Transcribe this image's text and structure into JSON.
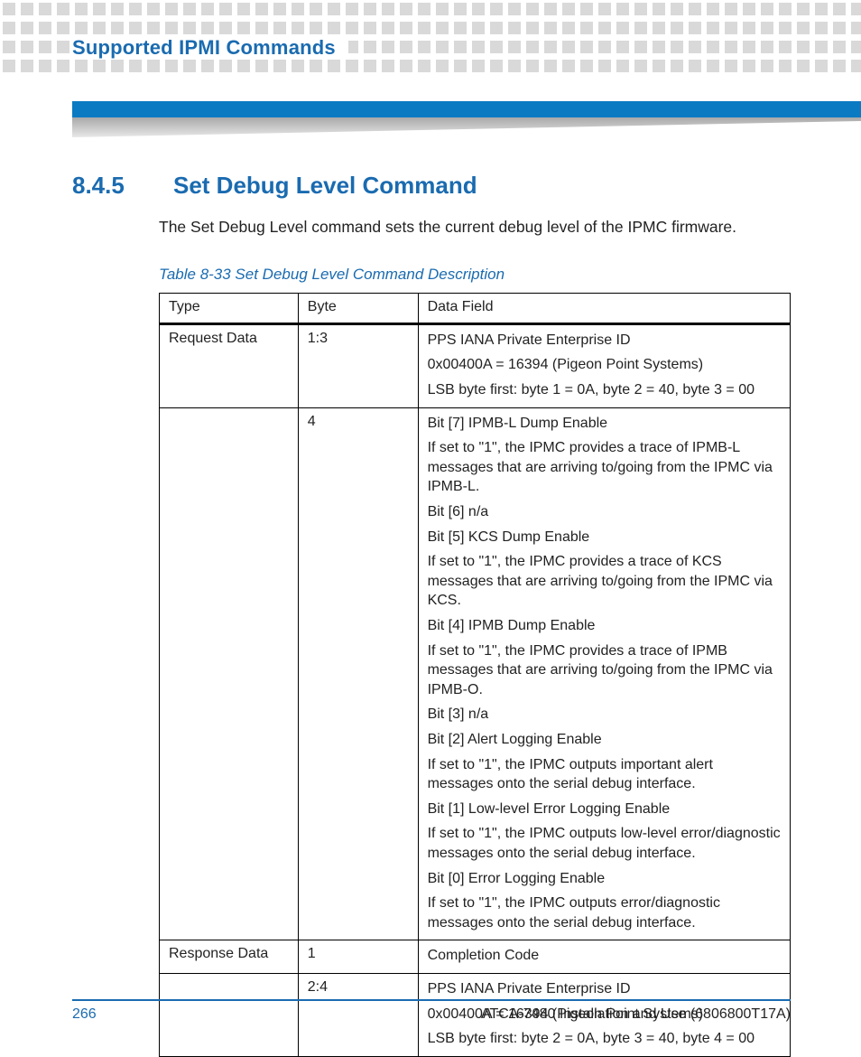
{
  "chapter_title": "Supported IPMI Commands",
  "section": {
    "number": "8.4.5",
    "title": "Set Debug Level Command",
    "intro": "The Set Debug Level command sets the current debug level of the IPMC firmware."
  },
  "table": {
    "caption": "Table 8-33 Set Debug Level Command Description",
    "headers": {
      "c1": "Type",
      "c2": "Byte",
      "c3": "Data Field"
    },
    "rows": [
      {
        "type": "Request Data",
        "byte": "1:3",
        "lines": [
          "PPS IANA Private Enterprise ID",
          "0x00400A = 16394 (Pigeon Point Systems)",
          "LSB byte first: byte 1 = 0A, byte 2 = 40, byte 3 = 00"
        ]
      },
      {
        "type": "",
        "byte": "4",
        "lines": [
          "Bit [7] IPMB-L Dump Enable",
          "If set to \"1\", the IPMC provides a trace of IPMB-L messages that are arriving to/going from the IPMC via IPMB-L.",
          "Bit [6] n/a",
          "Bit [5] KCS Dump Enable",
          "If set to \"1\", the IPMC provides a trace of KCS messages that are arriving to/going from the IPMC via KCS.",
          "Bit [4] IPMB Dump Enable",
          "If set to \"1\", the IPMC provides a trace of IPMB messages that are arriving to/going from the IPMC via IPMB-O.",
          "Bit [3] n/a",
          "Bit [2] Alert Logging Enable",
          "If set to \"1\", the IPMC outputs important alert messages onto the serial debug interface.",
          "Bit [1] Low-level Error Logging Enable",
          "If set to \"1\", the IPMC outputs low-level error/diagnostic messages onto the serial debug interface.",
          "Bit [0] Error Logging Enable",
          "If set to \"1\", the IPMC outputs error/diagnostic messages onto the serial debug interface."
        ]
      },
      {
        "type": "Response Data",
        "byte": "1",
        "lines": [
          "Completion Code"
        ]
      },
      {
        "type": "",
        "byte": "2:4",
        "lines": [
          "PPS IANA Private Enterprise ID",
          "0x00400A = 16394 (Pigeon Point Systems)",
          "LSB byte first: byte 2 = 0A, byte 3 = 40, byte 4 = 00"
        ]
      }
    ]
  },
  "footer": {
    "page": "266",
    "doc": "ATCA-7480 Installation and Use (6806800T17A)"
  }
}
